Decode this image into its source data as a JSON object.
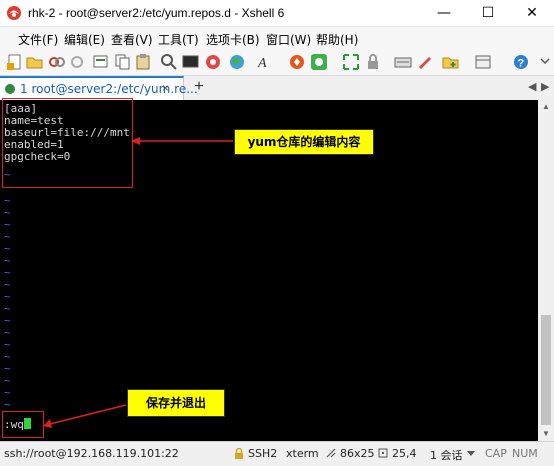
{
  "window": {
    "title": "rhk-2 - root@server2:/etc/yum.repos.d - Xshell 6",
    "minimize": "—",
    "maximize": "☐",
    "close": "✕"
  },
  "menu": {
    "items": [
      "文件(F)",
      "编辑(E)",
      "查看(V)",
      "工具(T)",
      "选项卡(B)",
      "窗口(W)",
      "帮助(H)"
    ]
  },
  "tab": {
    "label": "1 root@server2:/etc/yum.re...",
    "close": "×",
    "add": "+"
  },
  "terminal": {
    "lines": [
      "[aaa]",
      "name=test",
      "baseurl=file:///mnt",
      "enabled=1",
      "gpgcheck=0"
    ],
    "tilde": "~",
    "command": ":wq"
  },
  "annotations": {
    "edit_content": "yum仓库的编辑内容",
    "save_quit": "保存并退出"
  },
  "status": {
    "connection": "ssh://root@192.168.119.101:22",
    "protocol": "SSH2",
    "term_type": "xterm",
    "size": "86x25",
    "cursor_pos": "25,4",
    "sessions": "1 会话",
    "cap": "CAP",
    "num": "NUM"
  },
  "colors": {
    "terminal_bg": "#000000",
    "tilde": "#3a6fd6",
    "cursor": "#2bd640",
    "annotation_bg": "#ffff00",
    "highlight_box": "#e02020"
  }
}
